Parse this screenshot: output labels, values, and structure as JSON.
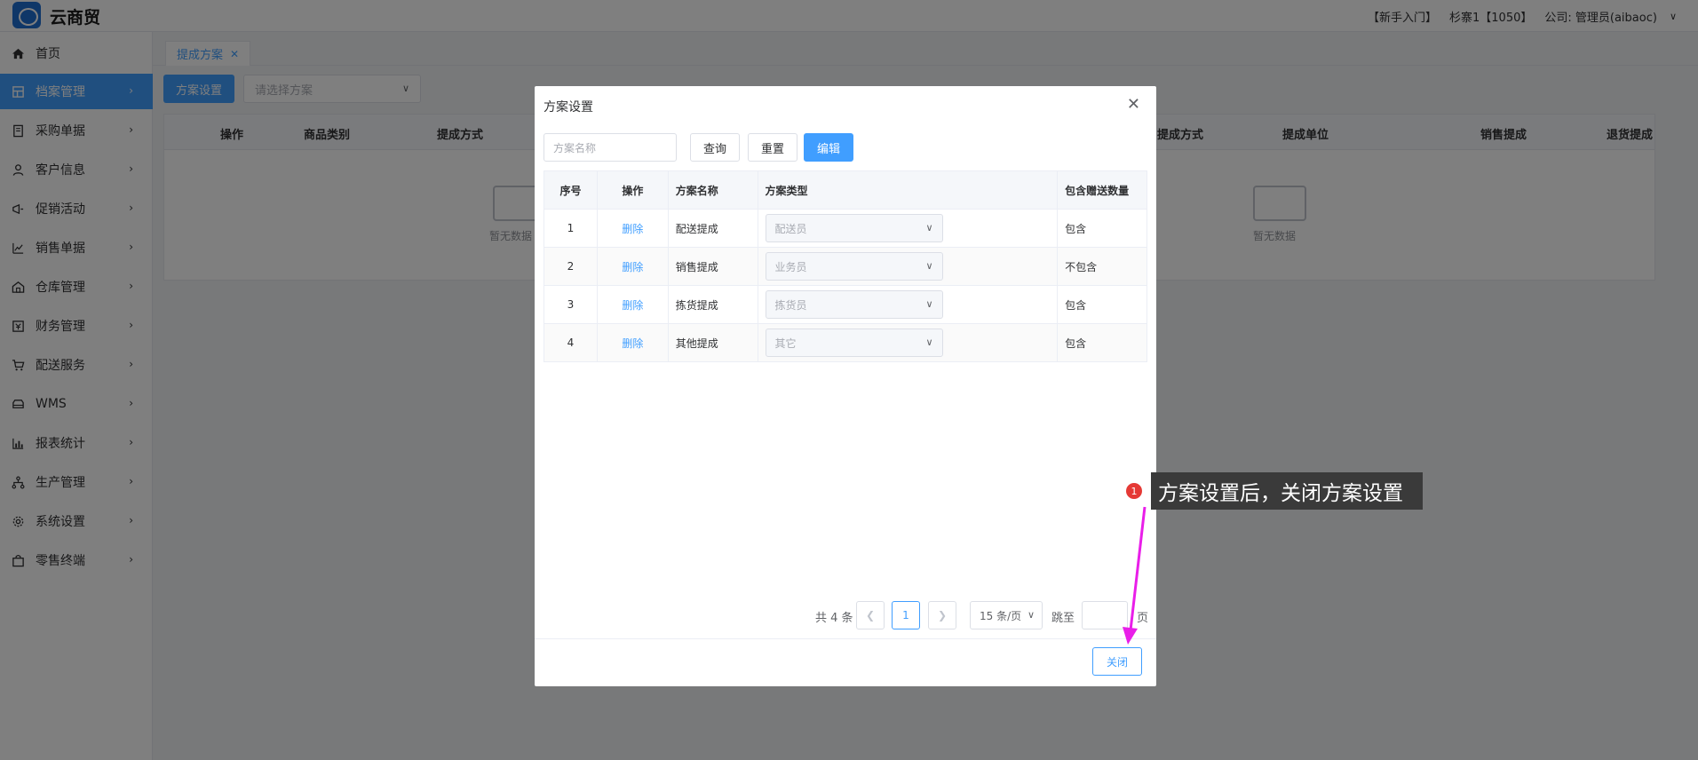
{
  "header": {
    "app_name": "云商贸",
    "links": [
      "【新手入门】",
      "杉寨1【1050】",
      "公司: 管理员(aibaoc)"
    ]
  },
  "sidebar": {
    "items": [
      {
        "label": "首页",
        "icon": "home-icon"
      },
      {
        "label": "档案管理",
        "icon": "archive-icon",
        "active": true
      },
      {
        "label": "采购单据",
        "icon": "document-icon"
      },
      {
        "label": "客户信息",
        "icon": "user-icon"
      },
      {
        "label": "促销活动",
        "icon": "megaphone-icon"
      },
      {
        "label": "销售单据",
        "icon": "chart-line-icon"
      },
      {
        "label": "仓库管理",
        "icon": "warehouse-icon"
      },
      {
        "label": "财务管理",
        "icon": "finance-icon"
      },
      {
        "label": "配送服务",
        "icon": "cart-icon"
      },
      {
        "label": "WMS",
        "icon": "truck-icon"
      },
      {
        "label": "报表统计",
        "icon": "bar-chart-icon"
      },
      {
        "label": "生产管理",
        "icon": "network-icon"
      },
      {
        "label": "系统设置",
        "icon": "gear-icon"
      },
      {
        "label": "零售终端",
        "icon": "bag-icon"
      }
    ]
  },
  "tabs": {
    "active": "提成方案"
  },
  "toolbar": {
    "scheme_button": "方案设置",
    "select_placeholder": "请选择方案"
  },
  "background_table": {
    "columns_left": [
      "操作",
      "商品类别",
      "提成方式"
    ],
    "columns_right": [
      "提成方式",
      "提成单位",
      "销售提成",
      "退货提成"
    ],
    "empty_text": "暂无数据"
  },
  "dialog": {
    "title": "方案设置",
    "search_placeholder": "方案名称",
    "buttons": {
      "query": "查询",
      "reset": "重置",
      "edit": "编辑"
    },
    "columns": [
      "序号",
      "操作",
      "方案名称",
      "方案类型",
      "包含赠送数量"
    ],
    "rows": [
      {
        "no": "1",
        "action": "删除",
        "name": "配送提成",
        "type": "配送员",
        "include_gift": "包含"
      },
      {
        "no": "2",
        "action": "删除",
        "name": "销售提成",
        "type": "业务员",
        "include_gift": "不包含"
      },
      {
        "no": "3",
        "action": "删除",
        "name": "拣货提成",
        "type": "拣货员",
        "include_gift": "包含"
      },
      {
        "no": "4",
        "action": "删除",
        "name": "其他提成",
        "type": "其它",
        "include_gift": "包含"
      }
    ],
    "pagination": {
      "total": "共 4 条",
      "current_page": "1",
      "page_size": "15 条/页",
      "jump_label": "跳至",
      "page_suffix": "页"
    },
    "close_button": "关闭"
  },
  "annotation": {
    "step": "1",
    "text": "方案设置后，关闭方案设置",
    "color": "#e91ee9"
  }
}
